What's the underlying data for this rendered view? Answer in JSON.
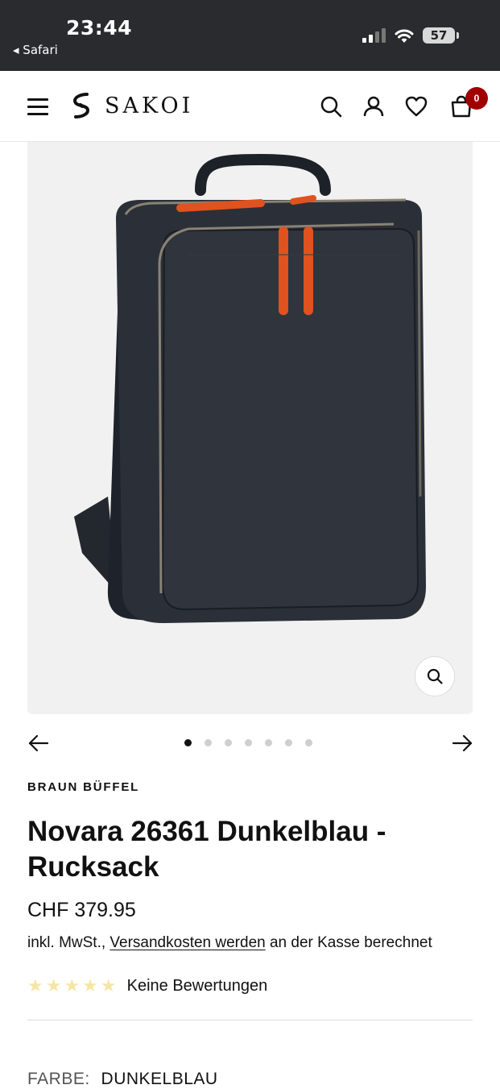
{
  "status_bar": {
    "time": "23:44",
    "back_app": "◂ Safari",
    "battery": "57"
  },
  "header": {
    "logo_text": "SAKOI",
    "cart_count": "0"
  },
  "product": {
    "brand": "BRAUN BÜFFEL",
    "title": "Novara 26361 Dunkelblau - Rucksack",
    "price": "CHF 379.95",
    "tax_prefix": "inkl. MwSt.,",
    "shipping_link": "Versandkosten werden",
    "tax_suffix": "an der Kasse berechnet",
    "stars": "★★★★★",
    "reviews": "Keine Bewertungen",
    "color_label": "FARBE:",
    "color_value": "DUNKELBLAU"
  },
  "carousel": {
    "total_images": 7,
    "active_index": 0
  },
  "colors": {
    "cart_badge": "#a10000",
    "bag": "#2b3038",
    "zipper_pull": "#e0521e",
    "stars": "#f6e6a6"
  }
}
